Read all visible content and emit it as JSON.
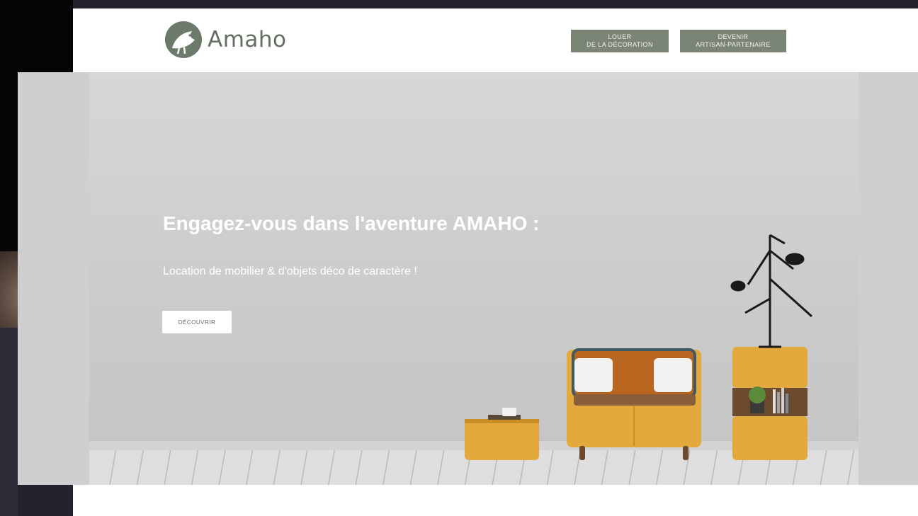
{
  "brand": {
    "name": "Amaho",
    "color": "#6b7a6a"
  },
  "nav": {
    "rent_line1": "LOUER",
    "rent_line2": "DE LA DÉCORATION",
    "partner_line1": "DEVENIR",
    "partner_line2": "ARTISAN-PARTENAIRE"
  },
  "hero": {
    "title": "Engagez-vous dans l'aventure AMAHO :",
    "subtitle": "Location de mobilier & d'objets déco de caractère !",
    "cta_label": "DÉCOUVRIR"
  },
  "icons": {
    "logo": "bird-logo-icon"
  }
}
